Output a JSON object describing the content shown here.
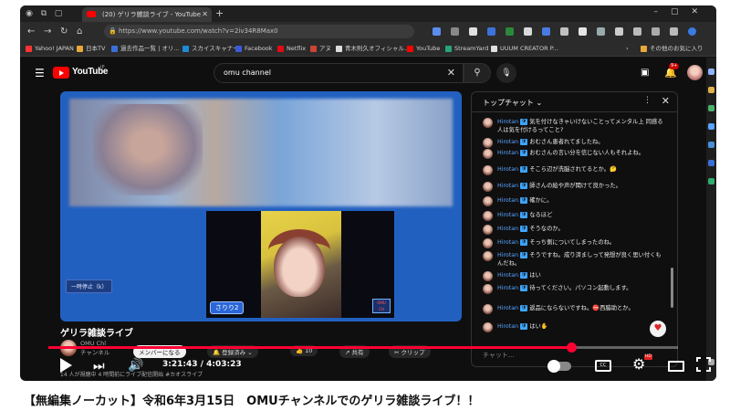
{
  "browser": {
    "tab_title": "(20) ゲリラ雑談ライブ - YouTube",
    "url": "https://www.youtube.com/watch?v=2iv34R8Max0",
    "bookmarks": [
      "Yahoo! JAPAN",
      "日本TV",
      "過去作品一覧 | オリ...",
      "スカイスキャナー",
      "Facebook",
      "Netflix",
      "アヌ",
      "青木則久オフィシャル...",
      "YouTube",
      "StreamYard",
      "UUUM CREATOR P..."
    ],
    "bookmark_folder": "その他のお気に入り"
  },
  "youtube": {
    "logo_text": "YouTube",
    "logo_region": "JP",
    "search_value": "omu channel",
    "notification_count": "9+"
  },
  "video": {
    "pause_chip": "一時停止（k）",
    "name_tag": "さりり2",
    "side_mark": "d",
    "title": "ゲリラ雑談ライブ",
    "channel_name": "OMU Chl",
    "channel_sub": "チャンネル",
    "member_button": "メンバーになる",
    "subscribed_button": "登録済み ⌄",
    "like_count": "10",
    "share_label": "共有",
    "clip_label": "クリップ",
    "meta_line": "14 人が視聴中  4 時間前にライブ配信開始  #カオスライブ",
    "time_current": "3:21:43",
    "time_total": "4:03:23",
    "progress": 0.83
  },
  "chat": {
    "header": "トップチャット ⌄",
    "input_placeholder": "チャット...",
    "messages": [
      {
        "author": "Hirotan",
        "text": "気を付けなきゃいけないことってメンタル上 同感る人は気を付けるってこと?"
      },
      {
        "author": "Hirotan",
        "text": "おむさん患者れてましたね。"
      },
      {
        "author": "Hirotan",
        "text": "おむさんの言い分を信じない人もそれよね。"
      },
      {
        "author": "Hirotan",
        "text": "そこら辺が洗脳されてるとか。🤔"
      },
      {
        "author": "Hirotan",
        "text": "師さんの絵や声が聞けて良かった。"
      },
      {
        "author": "Hirotan",
        "text": "確かに。"
      },
      {
        "author": "Hirotan",
        "text": "なるほど"
      },
      {
        "author": "Hirotan",
        "text": "そうなのか。"
      },
      {
        "author": "Hirotan",
        "text": "そっち側についてしまったのね。"
      },
      {
        "author": "Hirotan",
        "text": "そうですね。成り済ましって発想が良く思い付くもんだね。"
      },
      {
        "author": "Hirotan",
        "text": "はい"
      },
      {
        "author": "Hirotan",
        "text": "待ってください。パソコン起動します。"
      },
      {
        "author": "Hirotan",
        "text": "返品にならないですね。⛔西脇助とか。"
      },
      {
        "author": "Hirotan",
        "text": "はい✋"
      }
    ]
  },
  "caption": "【無編集ノーカット】令和6年3月15日　OMUチャンネルでのゲリラ雑談ライブ！！",
  "colors": {
    "yt_red": "#ff0000",
    "progress_red": "#ff0033",
    "video_bg": "#2260c0",
    "author_blue": "#5aa3ff"
  }
}
